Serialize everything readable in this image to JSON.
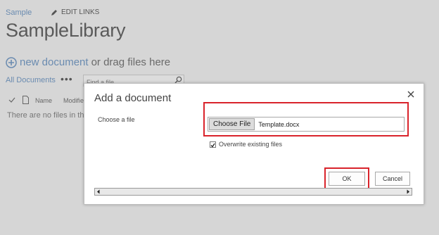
{
  "site": {
    "breadcrumb": "Sample",
    "edit_links": "EDIT LINKS"
  },
  "library": {
    "title": "SampleLibrary"
  },
  "new_document": {
    "link": "new document",
    "suffix": "or drag files here"
  },
  "views": {
    "current": "All Documents",
    "more": "•••"
  },
  "search": {
    "placeholder": "Find a file"
  },
  "columns": {
    "name": "Name",
    "modified": "Modifie"
  },
  "list": {
    "empty_message": "There are no files in th"
  },
  "dialog": {
    "title": "Add a document",
    "choose_label": "Choose a file",
    "choose_button": "Choose File",
    "file_name": "Template.docx",
    "overwrite_label": "Overwrite existing files",
    "overwrite_checked": true,
    "ok_label": "OK",
    "cancel_label": "Cancel"
  },
  "colors": {
    "link": "#6a8bb0",
    "highlight": "#d9232b",
    "overlay": "#d6d6d6"
  }
}
